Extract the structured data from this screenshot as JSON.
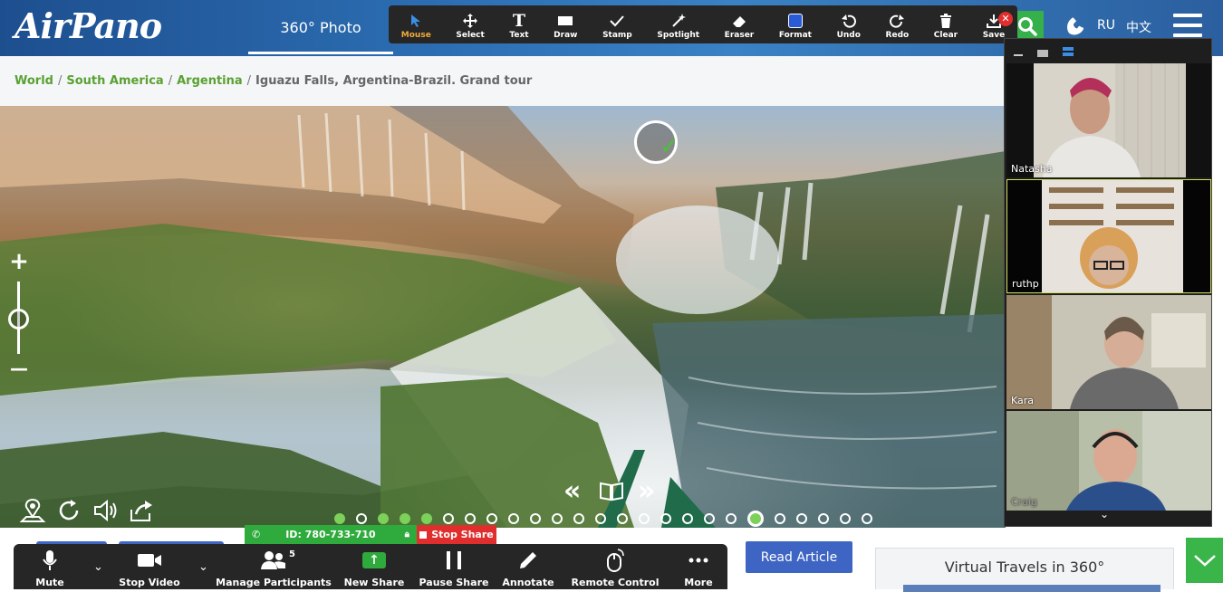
{
  "site": {
    "logo": "AirPano",
    "nav_tab": "360° Photo",
    "lang_ru": "RU",
    "lang_zh": "中文"
  },
  "annotate_toolbar": {
    "tools": [
      {
        "label": "Mouse",
        "icon": "mouse-arrow-icon",
        "active": true
      },
      {
        "label": "Select",
        "icon": "move-select-icon"
      },
      {
        "label": "Text",
        "icon": "text-icon"
      },
      {
        "label": "Draw",
        "icon": "draw-rect-icon"
      },
      {
        "label": "Stamp",
        "icon": "checkmark-stamp-icon"
      },
      {
        "label": "Spotlight",
        "icon": "spotlight-wand-icon"
      },
      {
        "label": "Eraser",
        "icon": "eraser-icon"
      },
      {
        "label": "Format",
        "icon": "format-color-icon"
      },
      {
        "label": "Undo",
        "icon": "undo-icon"
      },
      {
        "label": "Redo",
        "icon": "redo-icon"
      },
      {
        "label": "Clear",
        "icon": "trash-icon"
      },
      {
        "label": "Save",
        "icon": "save-download-icon"
      }
    ],
    "format_color": "#2a5bd7",
    "close_glyph": "✕"
  },
  "breadcrumb": {
    "items": [
      "World",
      "South America",
      "Argentina"
    ],
    "current": "Iguazu Falls, Argentina-Brazil. Grand tour"
  },
  "panorama": {
    "zoom_plus": "+",
    "zoom_minus": "—",
    "prev_glyph": "«",
    "next_glyph": "»",
    "dots_total": 25,
    "dots_visited": [
      0,
      2,
      3,
      4
    ],
    "dot_current": 19
  },
  "meeting": {
    "id_label": "ID: 780-733-710",
    "stop_share": "Stop Share",
    "participant_count": "5",
    "buttons": [
      {
        "label": "Mute",
        "icon": "microphone-icon"
      },
      {
        "label": "Stop Video",
        "icon": "video-camera-icon"
      },
      {
        "label": "Manage Participants",
        "icon": "participants-icon"
      },
      {
        "label": "New Share",
        "icon": "new-share-icon"
      },
      {
        "label": "Pause Share",
        "icon": "pause-icon"
      },
      {
        "label": "Annotate",
        "icon": "pencil-icon"
      },
      {
        "label": "Remote Control",
        "icon": "remote-mouse-icon"
      },
      {
        "label": "More",
        "icon": "more-dots-icon"
      }
    ],
    "new_share_color": "#2faa3c"
  },
  "participants": [
    {
      "name": "Natasha"
    },
    {
      "name": "ruthp",
      "active": true
    },
    {
      "name": "Kara"
    },
    {
      "name": "Craig"
    }
  ],
  "page_below": {
    "read_article": "Read Article",
    "virtual_travels": "Virtual Travels in 360°"
  },
  "colors": {
    "brand_blue": "#2c6db2",
    "accent_green": "#39b54a",
    "link_green": "#5aa132",
    "stop_red": "#e02e2e"
  }
}
